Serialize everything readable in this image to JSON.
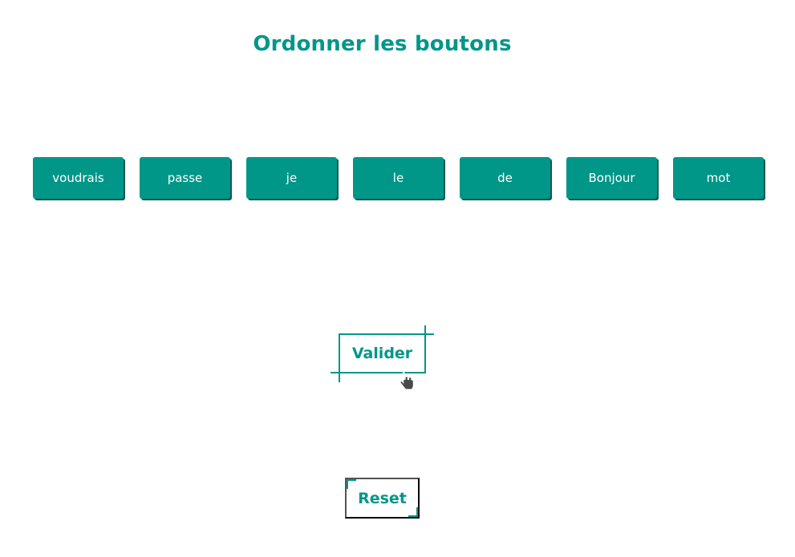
{
  "page": {
    "title": "Ordonner les boutons"
  },
  "words": [
    {
      "label": "voudrais"
    },
    {
      "label": "passe"
    },
    {
      "label": "je"
    },
    {
      "label": "le"
    },
    {
      "label": "de"
    },
    {
      "label": "Bonjour"
    },
    {
      "label": "mot"
    }
  ],
  "actions": {
    "validate_label": "Valider",
    "reset_label": "Reset"
  },
  "colors": {
    "accent": "#00968a",
    "button_shadow": "#0b5a52",
    "button_text": "#ffffff"
  },
  "icons": {
    "cursor": "hand-pointer-icon"
  }
}
